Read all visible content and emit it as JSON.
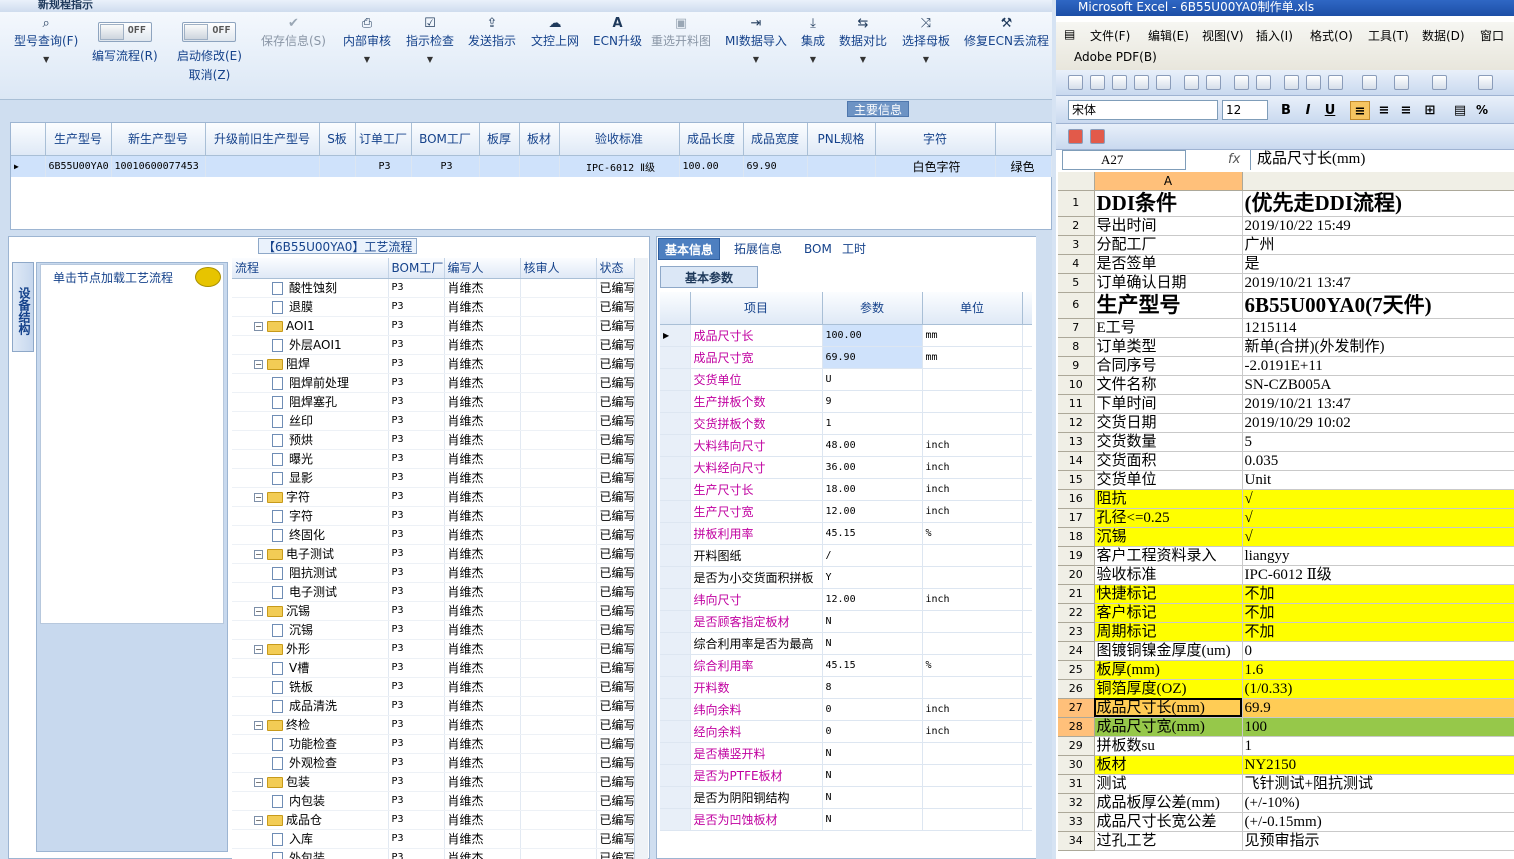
{
  "app": {
    "title": "新规程指示"
  },
  "ribbon": {
    "buttons": [
      {
        "label": "型号查询(F)",
        "icon": "magnifier-icon",
        "dropdown": true,
        "enabled": true
      },
      {
        "label": "编写流程(R)",
        "toggle": "OFF",
        "enabled": true
      },
      {
        "label": "启动修改(E)",
        "label2": "取消(Z)",
        "toggle": "OFF",
        "enabled": true
      },
      {
        "label": "保存信息(S)",
        "icon": "check-icon",
        "enabled": false
      },
      {
        "label": "内部审核",
        "icon": "printer-icon",
        "dropdown": true,
        "enabled": true
      },
      {
        "label": "指示检查",
        "icon": "checkbox-icon",
        "dropdown": true,
        "enabled": true
      },
      {
        "label": "发送指示",
        "icon": "upload-icon",
        "enabled": true
      },
      {
        "label": "文控上网",
        "icon": "cloud-upload-icon",
        "enabled": true
      },
      {
        "label": "ECN升级",
        "icon": "font-icon",
        "enabled": true
      },
      {
        "label": "重选开料图",
        "icon": "picture-icon",
        "enabled": false
      },
      {
        "label": "MI数据导入",
        "icon": "import-icon",
        "dropdown": true,
        "enabled": true
      },
      {
        "label": "集成",
        "icon": "download-icon",
        "dropdown": true,
        "enabled": true
      },
      {
        "label": "数据对比",
        "icon": "compare-icon",
        "dropdown": true,
        "enabled": true
      },
      {
        "label": "选择母板",
        "icon": "shuffle-icon",
        "dropdown": true,
        "enabled": true
      },
      {
        "label": "修复ECN丢流程",
        "icon": "wrench-icon",
        "enabled": true
      }
    ],
    "group_label": "主要信息"
  },
  "top_grid": {
    "columns": [
      "生产型号",
      "新生产型号",
      "升级前旧生产型号",
      "S板",
      "订单工厂",
      "BOM工厂",
      "板厚",
      "板材",
      "验收标准",
      "成品长度",
      "成品宽度",
      "PNL规格",
      "字符",
      ""
    ],
    "row": [
      "6B55U00YA0",
      "10010600077453",
      "",
      "",
      "P3",
      "P3",
      "",
      "",
      "IPC-6012 Ⅱ级",
      "100.00",
      "69.90",
      "",
      "白色字符",
      "绿色"
    ]
  },
  "process": {
    "title": "【6B55U00YA0】工艺流程",
    "side_tab": "设备结构",
    "node_hint": "单击节点加载工艺流程",
    "columns": [
      "流程",
      "BOM工厂",
      "编写人",
      "核审人",
      "状态"
    ],
    "rows": [
      {
        "name": "酸性蚀刻",
        "level": 2,
        "bom": "P3",
        "writer": "肖维杰",
        "status": "已编写"
      },
      {
        "name": "退膜",
        "level": 2,
        "bom": "P3",
        "writer": "肖维杰",
        "status": "已编写"
      },
      {
        "name": "AOI1",
        "level": 1,
        "bom": "P3",
        "writer": "肖维杰",
        "status": "已编写"
      },
      {
        "name": "外层AOI1",
        "level": 2,
        "bom": "P3",
        "writer": "肖维杰",
        "status": "已编写"
      },
      {
        "name": "阻焊",
        "level": 1,
        "bom": "P3",
        "writer": "肖维杰",
        "status": "已编写"
      },
      {
        "name": "阻焊前处理",
        "level": 2,
        "bom": "P3",
        "writer": "肖维杰",
        "status": "已编写"
      },
      {
        "name": "阻焊塞孔",
        "level": 2,
        "bom": "P3",
        "writer": "肖维杰",
        "status": "已编写"
      },
      {
        "name": "丝印",
        "level": 2,
        "bom": "P3",
        "writer": "肖维杰",
        "status": "已编写"
      },
      {
        "name": "预烘",
        "level": 2,
        "bom": "P3",
        "writer": "肖维杰",
        "status": "已编写"
      },
      {
        "name": "曝光",
        "level": 2,
        "bom": "P3",
        "writer": "肖维杰",
        "status": "已编写"
      },
      {
        "name": "显影",
        "level": 2,
        "bom": "P3",
        "writer": "肖维杰",
        "status": "已编写"
      },
      {
        "name": "字符",
        "level": 1,
        "bom": "P3",
        "writer": "肖维杰",
        "status": "已编写"
      },
      {
        "name": "字符",
        "level": 2,
        "bom": "P3",
        "writer": "肖维杰",
        "status": "已编写"
      },
      {
        "name": "终固化",
        "level": 2,
        "bom": "P3",
        "writer": "肖维杰",
        "status": "已编写"
      },
      {
        "name": "电子测试",
        "level": 1,
        "bom": "P3",
        "writer": "肖维杰",
        "status": "已编写"
      },
      {
        "name": "阻抗测试",
        "level": 2,
        "bom": "P3",
        "writer": "肖维杰",
        "status": "已编写"
      },
      {
        "name": "电子测试",
        "level": 2,
        "bom": "P3",
        "writer": "肖维杰",
        "status": "已编写"
      },
      {
        "name": "沉锡",
        "level": 1,
        "bom": "P3",
        "writer": "肖维杰",
        "status": "已编写"
      },
      {
        "name": "沉锡",
        "level": 2,
        "bom": "P3",
        "writer": "肖维杰",
        "status": "已编写"
      },
      {
        "name": "外形",
        "level": 1,
        "bom": "P3",
        "writer": "肖维杰",
        "status": "已编写"
      },
      {
        "name": "V槽",
        "level": 2,
        "bom": "P3",
        "writer": "肖维杰",
        "status": "已编写"
      },
      {
        "name": "铣板",
        "level": 2,
        "bom": "P3",
        "writer": "肖维杰",
        "status": "已编写"
      },
      {
        "name": "成品清洗",
        "level": 2,
        "bom": "P3",
        "writer": "肖维杰",
        "status": "已编写"
      },
      {
        "name": "终检",
        "level": 1,
        "bom": "P3",
        "writer": "肖维杰",
        "status": "已编写"
      },
      {
        "name": "功能检查",
        "level": 2,
        "bom": "P3",
        "writer": "肖维杰",
        "status": "已编写"
      },
      {
        "name": "外观检查",
        "level": 2,
        "bom": "P3",
        "writer": "肖维杰",
        "status": "已编写"
      },
      {
        "name": "包装",
        "level": 1,
        "bom": "P3",
        "writer": "肖维杰",
        "status": "已编写"
      },
      {
        "name": "内包装",
        "level": 2,
        "bom": "P3",
        "writer": "肖维杰",
        "status": "已编写"
      },
      {
        "name": "成品仓",
        "level": 1,
        "bom": "P3",
        "writer": "肖维杰",
        "status": "已编写"
      },
      {
        "name": "入库",
        "level": 2,
        "bom": "P3",
        "writer": "肖维杰",
        "status": "已编写"
      },
      {
        "name": "外包装",
        "level": 2,
        "bom": "P3",
        "writer": "肖维杰",
        "status": "已编写"
      }
    ]
  },
  "info": {
    "tabs": [
      "基本信息",
      "拓展信息",
      "BOM",
      "工时"
    ],
    "active_tab": "基本信息",
    "sub_tab": "基本参数",
    "columns": [
      "项目",
      "参数",
      "单位"
    ],
    "rows": [
      {
        "k": "成品尺寸长",
        "v": "100.00",
        "u": "mm",
        "pink": true,
        "sel": true
      },
      {
        "k": "成品尺寸宽",
        "v": "69.90",
        "u": "mm",
        "pink": true,
        "sel": true
      },
      {
        "k": "交货单位",
        "v": "U",
        "u": "",
        "pink": true
      },
      {
        "k": "生产拼板个数",
        "v": "9",
        "u": "",
        "pink": true
      },
      {
        "k": "交货拼板个数",
        "v": "1",
        "u": "",
        "pink": true
      },
      {
        "k": "大料纬向尺寸",
        "v": "48.00",
        "u": "inch",
        "pink": true
      },
      {
        "k": "大料经向尺寸",
        "v": "36.00",
        "u": "inch",
        "pink": true
      },
      {
        "k": "生产尺寸长",
        "v": "18.00",
        "u": "inch",
        "pink": true
      },
      {
        "k": "生产尺寸宽",
        "v": "12.00",
        "u": "inch",
        "pink": true
      },
      {
        "k": "拼板利用率",
        "v": "45.15",
        "u": "%",
        "pink": true
      },
      {
        "k": "开料图纸",
        "v": "/",
        "u": "",
        "pink": false
      },
      {
        "k": "是否为小交货面积拼板",
        "v": "Y",
        "u": "",
        "pink": false
      },
      {
        "k": "纬向尺寸",
        "v": "12.00",
        "u": "inch",
        "pink": true
      },
      {
        "k": "是否顾客指定板材",
        "v": "N",
        "u": "",
        "pink": true
      },
      {
        "k": "综合利用率是否为最高",
        "v": "N",
        "u": "",
        "pink": false
      },
      {
        "k": "综合利用率",
        "v": "45.15",
        "u": "%",
        "pink": true
      },
      {
        "k": "开料数",
        "v": "8",
        "u": "",
        "pink": true
      },
      {
        "k": "纬向余料",
        "v": "0",
        "u": "inch",
        "pink": true
      },
      {
        "k": "经向余料",
        "v": "0",
        "u": "inch",
        "pink": true
      },
      {
        "k": "是否横竖开料",
        "v": "N",
        "u": "",
        "pink": true
      },
      {
        "k": "是否为PTFE板材",
        "v": "N",
        "u": "",
        "pink": true
      },
      {
        "k": "是否为阴阳铜结构",
        "v": "N",
        "u": "",
        "pink": false
      },
      {
        "k": "是否为凹蚀板材",
        "v": "N",
        "u": "",
        "pink": true
      }
    ]
  },
  "excel": {
    "title": "Microsoft Excel - 6B55U00YA0制作单.xls",
    "menus": [
      "文件(F)",
      "编辑(E)",
      "视图(V)",
      "插入(I)",
      "格式(O)",
      "工具(T)",
      "数据(D)",
      "窗口"
    ],
    "menu2": "Adobe PDF(B)",
    "font": "宋体",
    "size": "12",
    "name_box": "A27",
    "fx": "fx",
    "formula": "成品尺寸长(mm)",
    "col_a": "A",
    "rows": [
      {
        "n": "1",
        "a": "DDI条件",
        "b": "(优先走DDI流程)",
        "style": "big"
      },
      {
        "n": "2",
        "a": "导出时间",
        "b": "2019/10/22 15:49"
      },
      {
        "n": "3",
        "a": "分配工厂",
        "b": "广州"
      },
      {
        "n": "4",
        "a": "是否签单",
        "b": "是"
      },
      {
        "n": "5",
        "a": "订单确认日期",
        "b": "2019/10/21 13:47"
      },
      {
        "n": "6",
        "a": "生产型号",
        "b": "6B55U00YA0(7天件)",
        "style": "big"
      },
      {
        "n": "7",
        "a": "E工号",
        "b": "1215114"
      },
      {
        "n": "8",
        "a": "订单类型",
        "b": "新单(合拼)(外发制作)"
      },
      {
        "n": "9",
        "a": "合同序号",
        "b": "-2.0191E+11"
      },
      {
        "n": "10",
        "a": "文件名称",
        "b": "SN-CZB005A"
      },
      {
        "n": "11",
        "a": "下单时间",
        "b": "2019/10/21 13:47"
      },
      {
        "n": "12",
        "a": "交货日期",
        "b": "2019/10/29 10:02"
      },
      {
        "n": "13",
        "a": "交货数量",
        "b": "5"
      },
      {
        "n": "14",
        "a": "交货面积",
        "b": "0.035"
      },
      {
        "n": "15",
        "a": "交货单位",
        "b": "Unit"
      },
      {
        "n": "16",
        "a": "阻抗",
        "b": "√",
        "style": "y"
      },
      {
        "n": "17",
        "a": "孔径<=0.25",
        "b": "√",
        "style": "y"
      },
      {
        "n": "18",
        "a": "沉锡",
        "b": "√",
        "style": "y"
      },
      {
        "n": "19",
        "a": "客户工程资料录入",
        "b": "liangyy"
      },
      {
        "n": "20",
        "a": "验收标准",
        "b": "IPC-6012 Ⅱ级"
      },
      {
        "n": "21",
        "a": "快捷标记",
        "b": "不加",
        "style": "y"
      },
      {
        "n": "22",
        "a": "客户标记",
        "b": "不加",
        "style": "y"
      },
      {
        "n": "23",
        "a": "周期标记",
        "b": "不加",
        "style": "y"
      },
      {
        "n": "24",
        "a": "图镀铜镍金厚度(um)",
        "b": "0"
      },
      {
        "n": "25",
        "a": "板厚(mm)",
        "b": "1.6",
        "style": "y"
      },
      {
        "n": "26",
        "a": "铜箔厚度(OZ)",
        "b": "(1/0.33)",
        "style": "y"
      },
      {
        "n": "27",
        "a": "成品尺寸长(mm)",
        "b": "69.9",
        "style": "act"
      },
      {
        "n": "28",
        "a": "成品尺寸宽(mm)",
        "b": "100",
        "style": "g"
      },
      {
        "n": "29",
        "a": "拼板数su",
        "b": "1"
      },
      {
        "n": "30",
        "a": "板材",
        "b": "NY2150",
        "style": "y"
      },
      {
        "n": "31",
        "a": "测试",
        "b": "飞针测试+阻抗测试"
      },
      {
        "n": "32",
        "a": "成品板厚公差(mm)",
        "b": "(+/-10%)"
      },
      {
        "n": "33",
        "a": "成品尺寸长宽公差",
        "b": "(+/-0.15mm)"
      },
      {
        "n": "34",
        "a": "过孔工艺",
        "b": "见预审指示"
      }
    ]
  }
}
